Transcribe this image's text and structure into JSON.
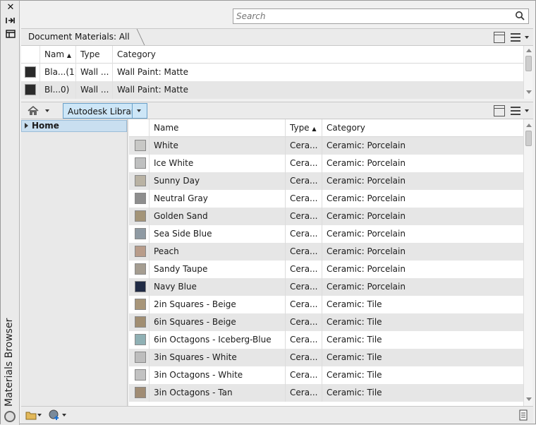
{
  "panel_title": "Materials Browser",
  "search": {
    "placeholder": "Search"
  },
  "document_materials": {
    "breadcrumb": "Document Materials: All",
    "columns": [
      "Nam",
      "Type",
      "Category"
    ],
    "rows": [
      {
        "name": "Bla...(1)",
        "type": "Wall ...",
        "category": "Wall Paint: Matte"
      },
      {
        "name": "Bl...0)",
        "type": "Wall ...",
        "category": "Wall Paint: Matte"
      }
    ]
  },
  "library": {
    "tab_label": "Autodesk Library",
    "tree": {
      "home_label": "Home"
    },
    "columns": [
      "Name",
      "Type",
      "Category"
    ],
    "rows": [
      {
        "name": "White",
        "type": "Cera...",
        "category": "Ceramic: Porcelain",
        "swatch": "#c8c8c6"
      },
      {
        "name": "Ice White",
        "type": "Cera...",
        "category": "Ceramic: Porcelain",
        "swatch": "#bfc0c0"
      },
      {
        "name": "Sunny Day",
        "type": "Cera...",
        "category": "Ceramic: Porcelain",
        "swatch": "#b9b2a3"
      },
      {
        "name": "Neutral Gray",
        "type": "Cera...",
        "category": "Ceramic: Porcelain",
        "swatch": "#8e8e8e"
      },
      {
        "name": "Golden Sand",
        "type": "Cera...",
        "category": "Ceramic: Porcelain",
        "swatch": "#a39478"
      },
      {
        "name": "Sea Side Blue",
        "type": "Cera...",
        "category": "Ceramic: Porcelain",
        "swatch": "#8f9aa3"
      },
      {
        "name": "Peach",
        "type": "Cera...",
        "category": "Ceramic: Porcelain",
        "swatch": "#b89c8a"
      },
      {
        "name": "Sandy Taupe",
        "type": "Cera...",
        "category": "Ceramic: Porcelain",
        "swatch": "#a59d91"
      },
      {
        "name": "Navy Blue",
        "type": "Cera...",
        "category": "Ceramic: Porcelain",
        "swatch": "#1f2a44"
      },
      {
        "name": "2in Squares - Beige",
        "type": "Cera...",
        "category": "Ceramic: Tile",
        "swatch": "#a8967a"
      },
      {
        "name": "6in Squares - Beige",
        "type": "Cera...",
        "category": "Ceramic: Tile",
        "swatch": "#a18e72"
      },
      {
        "name": "6in Octagons - Iceberg-Blue",
        "type": "Cera...",
        "category": "Ceramic: Tile",
        "swatch": "#8fb0b4"
      },
      {
        "name": "3in Squares - White",
        "type": "Cera...",
        "category": "Ceramic: Tile",
        "swatch": "#bdbdbd"
      },
      {
        "name": "3in Octagons - White",
        "type": "Cera...",
        "category": "Ceramic: Tile",
        "swatch": "#c2c2c2"
      },
      {
        "name": "3in Octagons - Tan",
        "type": "Cera...",
        "category": "Ceramic: Tile",
        "swatch": "#a08c74"
      }
    ]
  },
  "icons": {
    "close": "close-icon",
    "pin": "auto-hide-icon",
    "properties": "properties-icon",
    "search": "search-icon",
    "home": "home-icon"
  }
}
